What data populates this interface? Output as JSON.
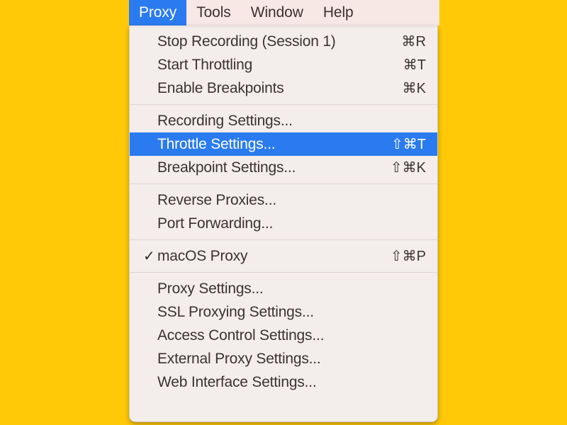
{
  "background_color": "#ffc907",
  "accent_color": "#2a7bf0",
  "menubar": {
    "background_color": "#f7e7e5",
    "items": [
      {
        "label": "Proxy",
        "active": true
      },
      {
        "label": "Tools",
        "active": false
      },
      {
        "label": "Window",
        "active": false
      },
      {
        "label": "Help",
        "active": false
      }
    ]
  },
  "menu": {
    "title": "Proxy",
    "groups": [
      {
        "items": [
          {
            "label": "Stop Recording (Session 1)",
            "shortcut": "⌘R",
            "checked": false,
            "selected": false
          },
          {
            "label": "Start Throttling",
            "shortcut": "⌘T",
            "checked": false,
            "selected": false
          },
          {
            "label": "Enable Breakpoints",
            "shortcut": "⌘K",
            "checked": false,
            "selected": false
          }
        ]
      },
      {
        "items": [
          {
            "label": "Recording Settings...",
            "shortcut": "",
            "checked": false,
            "selected": false
          },
          {
            "label": "Throttle Settings...",
            "shortcut": "⇧⌘T",
            "checked": false,
            "selected": true
          },
          {
            "label": "Breakpoint Settings...",
            "shortcut": "⇧⌘K",
            "checked": false,
            "selected": false
          }
        ]
      },
      {
        "items": [
          {
            "label": "Reverse Proxies...",
            "shortcut": "",
            "checked": false,
            "selected": false
          },
          {
            "label": "Port Forwarding...",
            "shortcut": "",
            "checked": false,
            "selected": false
          }
        ]
      },
      {
        "items": [
          {
            "label": "macOS Proxy",
            "shortcut": "⇧⌘P",
            "checked": true,
            "check_glyph": "✓",
            "selected": false
          }
        ]
      },
      {
        "items": [
          {
            "label": "Proxy Settings...",
            "shortcut": "",
            "checked": false,
            "selected": false
          },
          {
            "label": "SSL Proxying Settings...",
            "shortcut": "",
            "checked": false,
            "selected": false
          },
          {
            "label": "Access Control Settings...",
            "shortcut": "",
            "checked": false,
            "selected": false
          },
          {
            "label": "External Proxy Settings...",
            "shortcut": "",
            "checked": false,
            "selected": false
          },
          {
            "label": "Web Interface Settings...",
            "shortcut": "",
            "checked": false,
            "selected": false
          }
        ]
      }
    ]
  }
}
